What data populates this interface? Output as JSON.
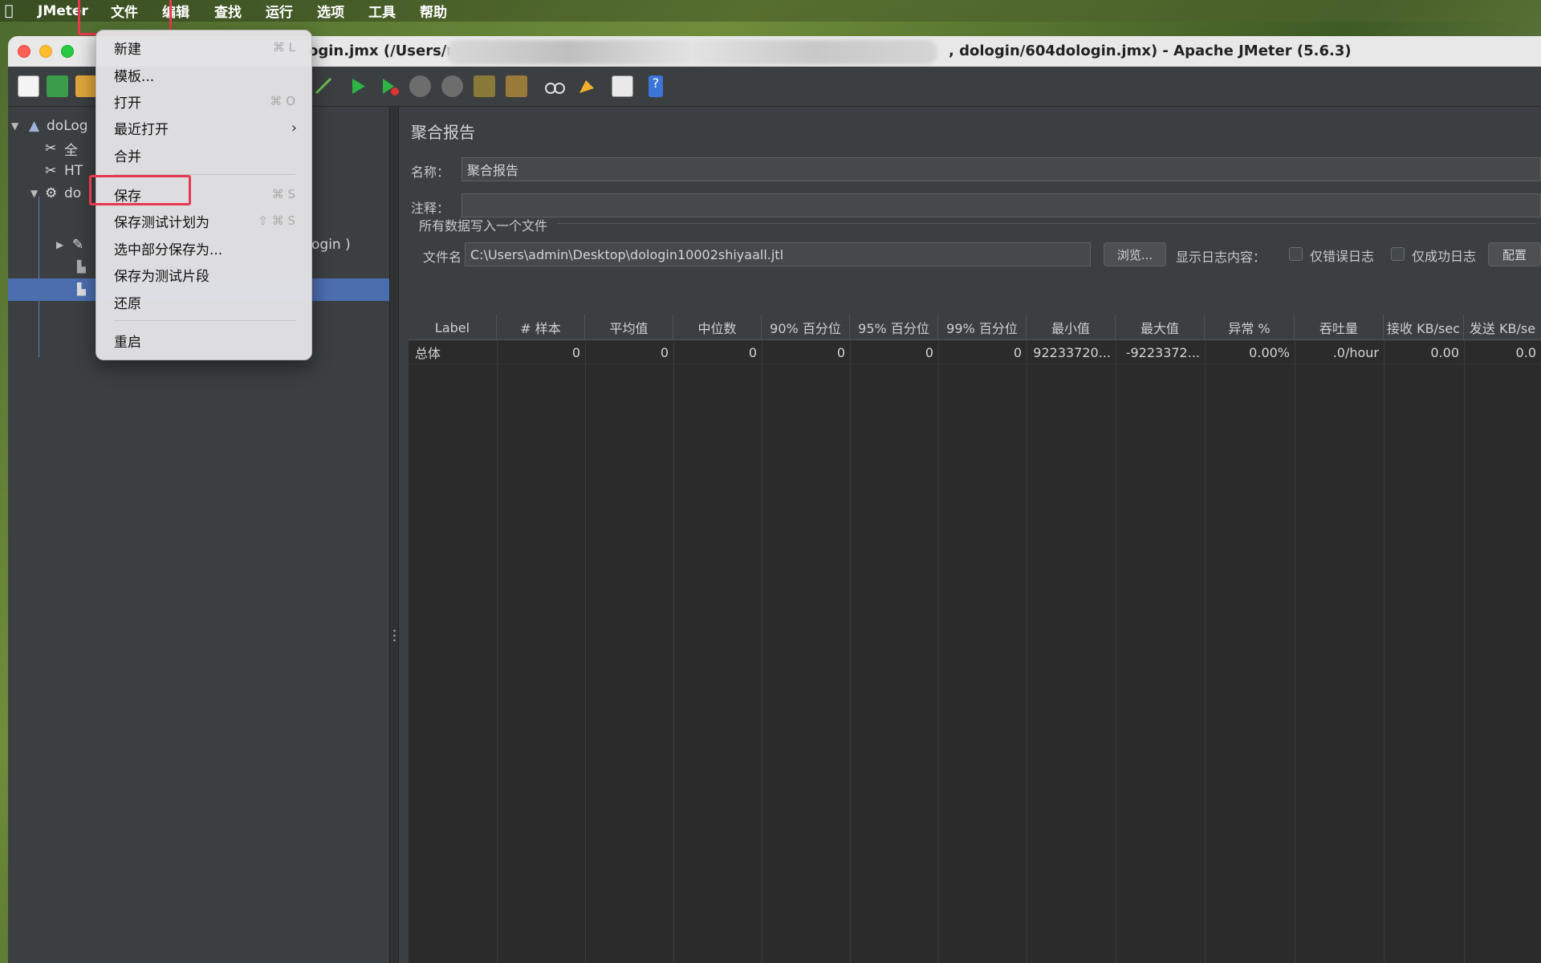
{
  "menubar": {
    "app": "JMeter",
    "items": [
      "文件",
      "编辑",
      "查找",
      "运行",
      "选项",
      "工具",
      "帮助"
    ]
  },
  "window": {
    "title_left": "ogin.jmx (/Users/m",
    "title_right": ", dologin/604dologin.jmx) - Apache JMeter (5.6.3)"
  },
  "file_menu": {
    "items": [
      {
        "label": "新建",
        "shortcut": "⌘ L"
      },
      {
        "label": "模板...",
        "shortcut": ""
      },
      {
        "label": "打开",
        "shortcut": "⌘ O"
      },
      {
        "label": "最近打开",
        "shortcut": "",
        "submenu": "›"
      },
      {
        "label": "合并",
        "shortcut": ""
      },
      {
        "label": "保存",
        "shortcut": "⌘ S"
      },
      {
        "label": "保存测试计划为",
        "shortcut": "⇧ ⌘ S"
      },
      {
        "label": "选中部分保存为...",
        "shortcut": ""
      },
      {
        "label": "保存为测试片段",
        "shortcut": ""
      },
      {
        "label": "还原",
        "shortcut": ""
      },
      {
        "label": "重启",
        "shortcut": ""
      }
    ]
  },
  "tree": {
    "root": "doLog",
    "child1": "全",
    "child2": "HT",
    "child3": "do",
    "partial_label": "ogin )"
  },
  "report": {
    "panel_title": "聚合报告",
    "name_label": "名称：",
    "name_value": "聚合报告",
    "comment_label": "注释：",
    "comment_value": "",
    "section_title": "所有数据写入一个文件",
    "file_label": "文件名",
    "file_value": "C:\\Users\\admin\\Desktop\\dologin10002shiyaall.jtl",
    "browse_button": "浏览...",
    "log_label": "显示日志内容：",
    "errors_only": "仅错误日志",
    "success_only": "仅成功日志",
    "configure_button": "配置"
  },
  "table": {
    "headers": [
      "Label",
      "# 样本",
      "平均值",
      "中位数",
      "90% 百分位",
      "95% 百分位",
      "99% 百分位",
      "最小值",
      "最大值",
      "异常 %",
      "吞吐量",
      "接收 KB/sec",
      "发送 KB/se"
    ],
    "rows": [
      [
        "总体",
        "0",
        "0",
        "0",
        "0",
        "0",
        "0",
        "92233720...",
        "-9223372...",
        "0.00%",
        ".0/hour",
        "0.00",
        "0.0"
      ]
    ]
  },
  "colors": {
    "accent_selection": "#4b6eaf",
    "highlight_box": "#e8384f"
  }
}
